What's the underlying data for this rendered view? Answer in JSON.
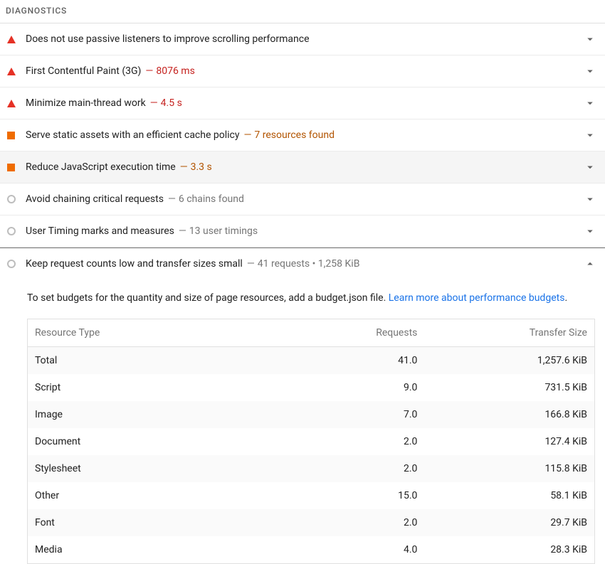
{
  "section_title": "DIAGNOSTICS",
  "audits": [
    {
      "severity": "fail",
      "title": "Does not use passive listeners to improve scrolling performance",
      "detail": "",
      "expanded": false
    },
    {
      "severity": "fail",
      "title": "First Contentful Paint (3G)",
      "detail": "8076 ms",
      "expanded": false
    },
    {
      "severity": "fail",
      "title": "Minimize main-thread work",
      "detail": "4.5 s",
      "expanded": false
    },
    {
      "severity": "average",
      "title": "Serve static assets with an efficient cache policy",
      "detail": "7 resources found",
      "expanded": false
    },
    {
      "severity": "average",
      "title": "Reduce JavaScript execution time",
      "detail": "3.3 s",
      "expanded": false,
      "highlight": true
    },
    {
      "severity": "info",
      "title": "Avoid chaining critical requests",
      "detail": "6 chains found",
      "expanded": false
    },
    {
      "severity": "info",
      "title": "User Timing marks and measures",
      "detail": "13 user timings",
      "expanded": false
    },
    {
      "severity": "info",
      "title": "Keep request counts low and transfer sizes small",
      "detail": "41 requests • 1,258 KiB",
      "expanded": true
    }
  ],
  "expanded_audit": {
    "description_prefix": "To set budgets for the quantity and size of page resources, add a budget.json file. ",
    "link_text": "Learn more about performance budgets",
    "description_suffix": ".",
    "table": {
      "headers": [
        "Resource Type",
        "Requests",
        "Transfer Size"
      ],
      "rows": [
        {
          "type": "Total",
          "requests": "41.0",
          "size": "1,257.6 KiB"
        },
        {
          "type": "Script",
          "requests": "9.0",
          "size": "731.5 KiB"
        },
        {
          "type": "Image",
          "requests": "7.0",
          "size": "166.8 KiB"
        },
        {
          "type": "Document",
          "requests": "2.0",
          "size": "127.4 KiB"
        },
        {
          "type": "Stylesheet",
          "requests": "2.0",
          "size": "115.8 KiB"
        },
        {
          "type": "Other",
          "requests": "15.0",
          "size": "58.1 KiB"
        },
        {
          "type": "Font",
          "requests": "2.0",
          "size": "29.7 KiB"
        },
        {
          "type": "Media",
          "requests": "4.0",
          "size": "28.3 KiB"
        }
      ]
    }
  }
}
